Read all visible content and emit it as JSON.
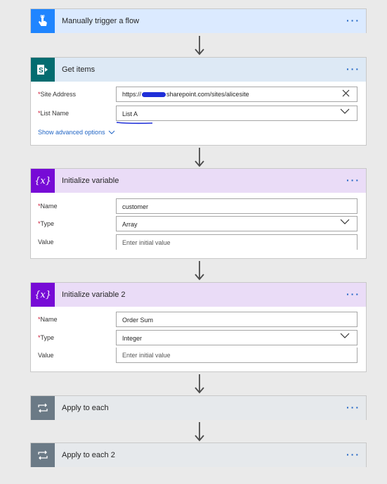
{
  "trigger": {
    "title": "Manually trigger a flow",
    "more": "···",
    "color": "#1f85ff",
    "icon": "touch-icon"
  },
  "get_items": {
    "title": "Get items",
    "more": "···",
    "color": "#036c70",
    "icon": "sharepoint-icon",
    "site_address_label": "Site Address",
    "site_address_prefix": "https://",
    "site_address_suffix": "sharepoint.com/sites/alicesite",
    "list_name_label": "List Name",
    "list_name_value": "List A",
    "advanced_link": "Show advanced options"
  },
  "init_var1": {
    "title": "Initialize variable",
    "more": "···",
    "color": "#770bd6",
    "icon": "variable-icon",
    "name_label": "Name",
    "name_value": "customer",
    "type_label": "Type",
    "type_value": "Array",
    "value_label": "Value",
    "value_placeholder": "Enter initial value"
  },
  "init_var2": {
    "title": "Initialize variable 2",
    "more": "···",
    "color": "#770bd6",
    "icon": "variable-icon",
    "name_label": "Name",
    "name_value": "Order Sum",
    "type_label": "Type",
    "type_value": "Integer",
    "value_label": "Value",
    "value_placeholder": "Enter initial value"
  },
  "apply1": {
    "title": "Apply to each",
    "more": "···",
    "color": "#6b7a86",
    "icon": "loop-icon"
  },
  "apply2": {
    "title": "Apply to each 2",
    "more": "···",
    "color": "#6b7a86",
    "icon": "loop-icon"
  },
  "required_mark": "*",
  "var_glyph": "{x}"
}
